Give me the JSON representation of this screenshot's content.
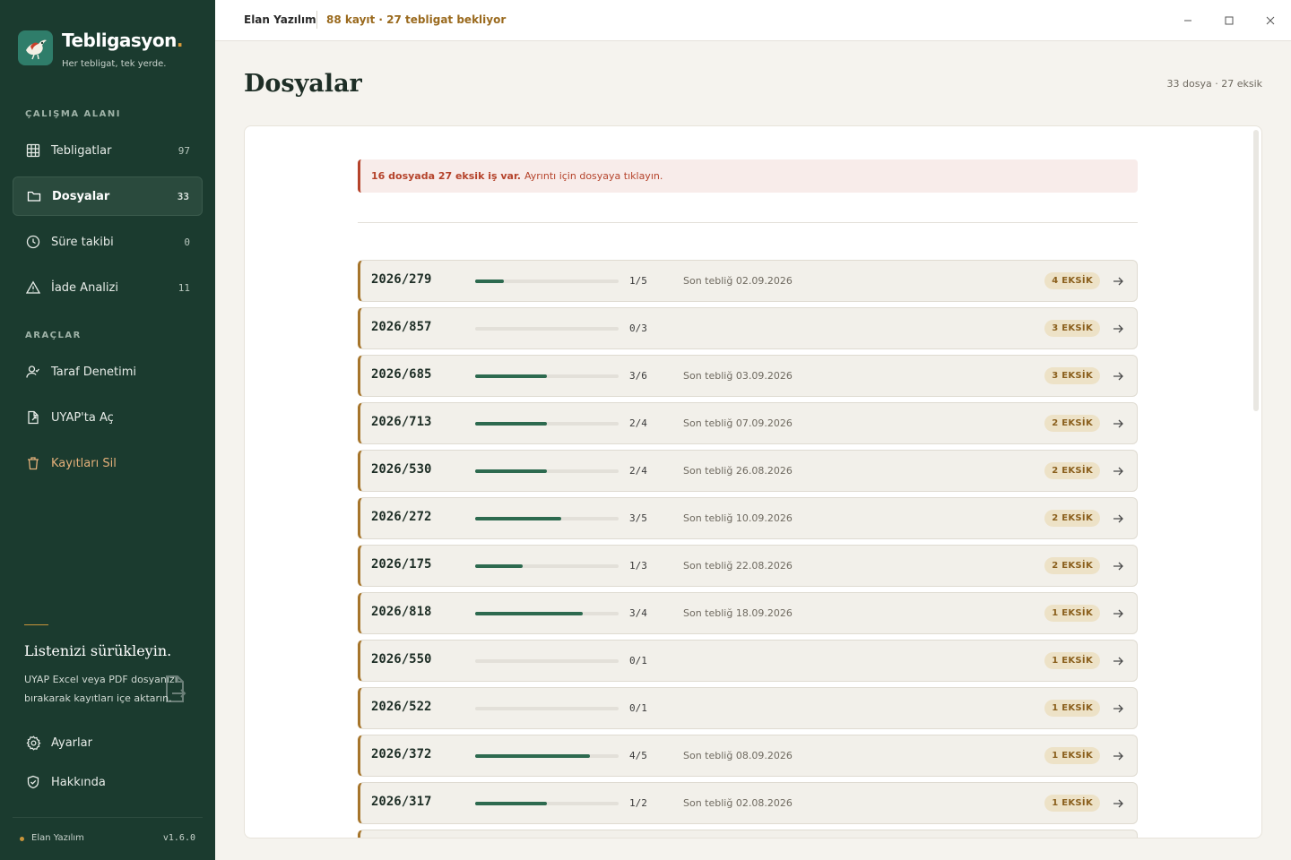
{
  "app": {
    "name": "Tebligasyon",
    "name_dot": ".",
    "tagline": "Her tebligat, tek yerde."
  },
  "sidebar": {
    "workspace_label": "ÇALIŞMA ALANI",
    "workspace_items": [
      {
        "label": "Tebligatlar",
        "count": "97",
        "icon": "grid-icon"
      },
      {
        "label": "Dosyalar",
        "count": "33",
        "icon": "folder-icon",
        "active": true
      },
      {
        "label": "Süre takibi",
        "count": "0",
        "icon": "clock-icon"
      },
      {
        "label": "İade Analizi",
        "count": "11",
        "icon": "warning-icon"
      }
    ],
    "tools_label": "ARAÇLAR",
    "tool_items": [
      {
        "label": "Taraf Denetimi",
        "icon": "user-check-icon"
      },
      {
        "label": "UYAP'ta Aç",
        "icon": "external-file-icon"
      },
      {
        "label": "Kayıtları Sil",
        "icon": "trash-icon"
      }
    ],
    "drop_title": "Listenizi sürükleyin.",
    "drop_desc": "UYAP Excel veya PDF dosyanızı bırakarak kayıtları içe aktarın.",
    "bottom_items": [
      {
        "label": "Ayarlar",
        "icon": "gear-icon"
      },
      {
        "label": "Hakkında",
        "icon": "shield-icon"
      }
    ],
    "footer_name": "Elan Yazılım",
    "footer_version": "v1.6.0"
  },
  "topbar": {
    "org": "Elan Yazılım",
    "status": "88 kayıt · 27 tebligat bekliyor"
  },
  "page": {
    "title": "Dosyalar",
    "meta": "33 dosya · 27 eksik"
  },
  "alert": {
    "strong": "16 dosyada 27 eksik iş var.",
    "text": "Ayrıntı için dosyaya tıklayın."
  },
  "files": [
    {
      "no": "2026/279",
      "done": 1,
      "total": 5,
      "ratio": "1/5",
      "last": "Son tebliğ 02.09.2026",
      "badge": "4 EKSİK"
    },
    {
      "no": "2026/857",
      "done": 0,
      "total": 3,
      "ratio": "0/3",
      "last": "",
      "badge": "3 EKSİK"
    },
    {
      "no": "2026/685",
      "done": 3,
      "total": 6,
      "ratio": "3/6",
      "last": "Son tebliğ 03.09.2026",
      "badge": "3 EKSİK"
    },
    {
      "no": "2026/713",
      "done": 2,
      "total": 4,
      "ratio": "2/4",
      "last": "Son tebliğ 07.09.2026",
      "badge": "2 EKSİK"
    },
    {
      "no": "2026/530",
      "done": 2,
      "total": 4,
      "ratio": "2/4",
      "last": "Son tebliğ 26.08.2026",
      "badge": "2 EKSİK"
    },
    {
      "no": "2026/272",
      "done": 3,
      "total": 5,
      "ratio": "3/5",
      "last": "Son tebliğ 10.09.2026",
      "badge": "2 EKSİK"
    },
    {
      "no": "2026/175",
      "done": 1,
      "total": 3,
      "ratio": "1/3",
      "last": "Son tebliğ 22.08.2026",
      "badge": "2 EKSİK"
    },
    {
      "no": "2026/818",
      "done": 3,
      "total": 4,
      "ratio": "3/4",
      "last": "Son tebliğ 18.09.2026",
      "badge": "1 EKSİK"
    },
    {
      "no": "2026/550",
      "done": 0,
      "total": 1,
      "ratio": "0/1",
      "last": "",
      "badge": "1 EKSİK"
    },
    {
      "no": "2026/522",
      "done": 0,
      "total": 1,
      "ratio": "0/1",
      "last": "",
      "badge": "1 EKSİK"
    },
    {
      "no": "2026/372",
      "done": 4,
      "total": 5,
      "ratio": "4/5",
      "last": "Son tebliğ 08.09.2026",
      "badge": "1 EKSİK"
    },
    {
      "no": "2026/317",
      "done": 1,
      "total": 2,
      "ratio": "1/2",
      "last": "Son tebliğ 02.08.2026",
      "badge": "1 EKSİK"
    }
  ],
  "colors": {
    "sidebar_bg": "#1b3b2f",
    "accent_gold": "#a6752b",
    "progress": "#2d6a4f",
    "alert_red": "#b5432b"
  }
}
